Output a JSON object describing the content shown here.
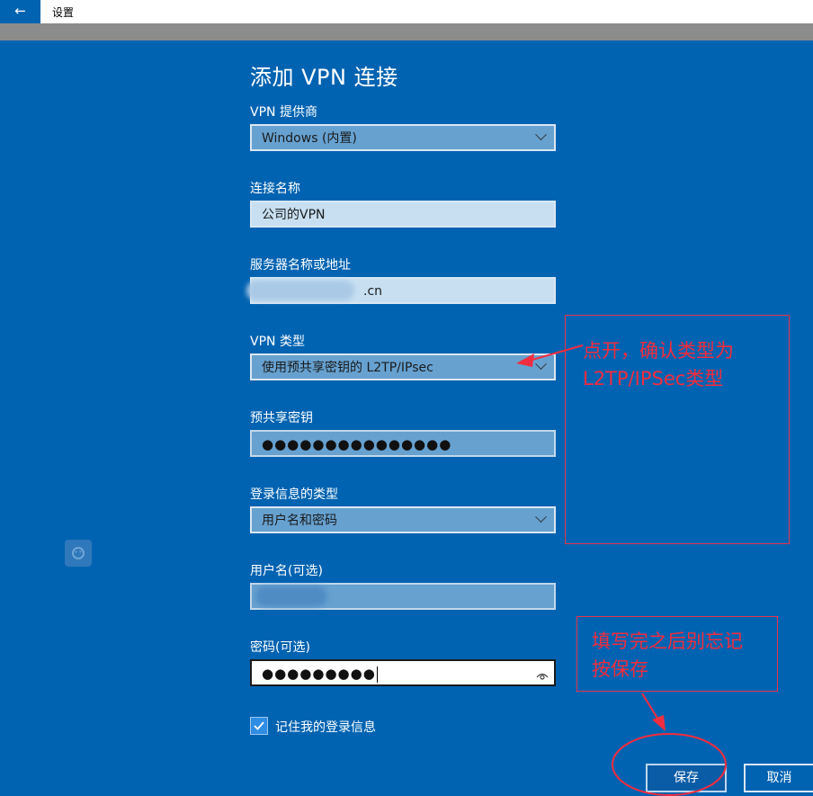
{
  "window": {
    "title": "设置"
  },
  "dialog": {
    "title": "添加 VPN 连接",
    "provider": {
      "label": "VPN 提供商",
      "value": "Windows (内置)"
    },
    "connection_name": {
      "label": "连接名称",
      "value": "公司的VPN"
    },
    "server": {
      "label": "服务器名称或地址",
      "value_suffix": ".cn"
    },
    "vpn_type": {
      "label": "VPN 类型",
      "value": "使用预共享密钥的 L2TP/IPsec"
    },
    "psk": {
      "label": "预共享密钥",
      "value": "●●●●●●●●●●●●●●●"
    },
    "signin_type": {
      "label": "登录信息的类型",
      "value": "用户名和密码"
    },
    "username": {
      "label": "用户名(可选)"
    },
    "password": {
      "label": "密码(可选)",
      "value": "●●●●●●●●●"
    },
    "remember": {
      "label": "记住我的登录信息",
      "checked": true
    },
    "save_label": "保存",
    "cancel_label": "取消"
  },
  "annotations": {
    "note1_line1": "点开，确认类型为",
    "note1_line2": "L2TP/IPSec类型",
    "note2_line1": "填写完之后别忘记",
    "note2_line2": "按保存"
  },
  "colors": {
    "background": "#0063b1",
    "annotation": "#f22d3f"
  }
}
